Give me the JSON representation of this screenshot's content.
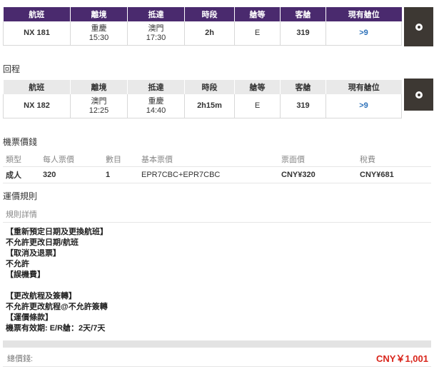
{
  "outbound": {
    "headers": [
      "航班",
      "離境",
      "抵達",
      "時段",
      "艙等",
      "客艙",
      "現有艙位"
    ],
    "row": {
      "flight": "NX 181",
      "depart_city": "重慶",
      "depart_time": "15:30",
      "arrive_city": "澳門",
      "arrive_time": "17:30",
      "duration": "2h",
      "class": "E",
      "cabin": "319",
      "availability": ">9"
    }
  },
  "return_label": "回程",
  "return": {
    "headers": [
      "航班",
      "離境",
      "抵達",
      "時段",
      "艙等",
      "客艙",
      "現有艙位"
    ],
    "row": {
      "flight": "NX 182",
      "depart_city": "澳門",
      "depart_time": "12:25",
      "arrive_city": "重慶",
      "arrive_time": "14:40",
      "duration": "2h15m",
      "class": "E",
      "cabin": "319",
      "availability": ">9"
    }
  },
  "fare": {
    "title": "機票價錢",
    "headers": [
      "類型",
      "每人票價",
      "數目",
      "基本票價",
      "票面價",
      "稅費"
    ],
    "row": [
      "成人",
      "320",
      "1",
      "EPR7CBC+EPR7CBC",
      "CNY¥320",
      "CNY¥681"
    ]
  },
  "rules": {
    "title": "運價規則",
    "detail_header": "規則詳情",
    "lines": [
      {
        "text": "【重新預定日期及更換航班】",
        "bold": true
      },
      {
        "text": "不允許更改日期/航班",
        "bold": true
      },
      {
        "text": "【取消及退票】",
        "bold": true
      },
      {
        "text": "不允許",
        "bold": true
      },
      {
        "text": "【誤機費】",
        "bold": true
      },
      {
        "text": "",
        "bold": false
      },
      {
        "text": "【更改航程及簽轉】",
        "bold": true
      },
      {
        "text": "不允許更改航程@不允許簽轉",
        "bold": true
      },
      {
        "text": "【運價條款】",
        "bold": true
      },
      {
        "text": "機票有效期: E/R艙：2天/7天",
        "bold": true
      }
    ]
  },
  "total": {
    "label": "總價錢:",
    "value": "CNY￥1,001"
  },
  "colors": {
    "header_purple": "#4a2a6e",
    "select_box": "#3d3833",
    "availability_blue": "#2a6fb8",
    "total_red": "#d9261c"
  }
}
